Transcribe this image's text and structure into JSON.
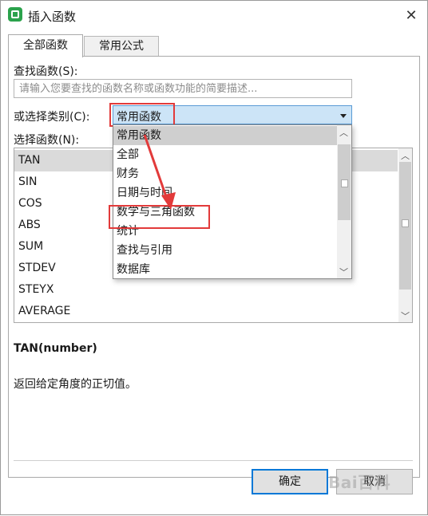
{
  "window": {
    "title": "插入函数",
    "close_glyph": "✕"
  },
  "tabs": [
    {
      "label": "全部函数",
      "active": true
    },
    {
      "label": "常用公式",
      "active": false
    }
  ],
  "search": {
    "label": "查找函数(S):",
    "placeholder": "请输入您要查找的函数名称或函数功能的简要描述..."
  },
  "category": {
    "label": "或选择类别(C):",
    "value": "常用函数",
    "options": [
      "常用函数",
      "全部",
      "财务",
      "日期与时间",
      "数学与三角函数",
      "统计",
      "查找与引用",
      "数据库"
    ],
    "selected_index": 0,
    "highlighted_option": "数学与三角函数"
  },
  "function_list": {
    "label": "选择函数(N):",
    "items": [
      "TAN",
      "SIN",
      "COS",
      "ABS",
      "SUM",
      "STDEV",
      "STEYX",
      "AVERAGE"
    ],
    "selected_index": 0
  },
  "function_info": {
    "syntax": "TAN(number)",
    "description": "返回给定角度的正切值。"
  },
  "buttons": {
    "ok": "确定",
    "cancel": "取消"
  },
  "watermark": "Bai百科",
  "colors": {
    "annotation_red": "#e23a3a",
    "select_highlight": "#cce4f7",
    "ok_border": "#0078d7",
    "app_icon": "#2ba24c"
  },
  "icons": [
    "app-icon",
    "close-icon",
    "dropdown-arrow-icon",
    "scroll-up-icon",
    "scroll-down-icon"
  ]
}
